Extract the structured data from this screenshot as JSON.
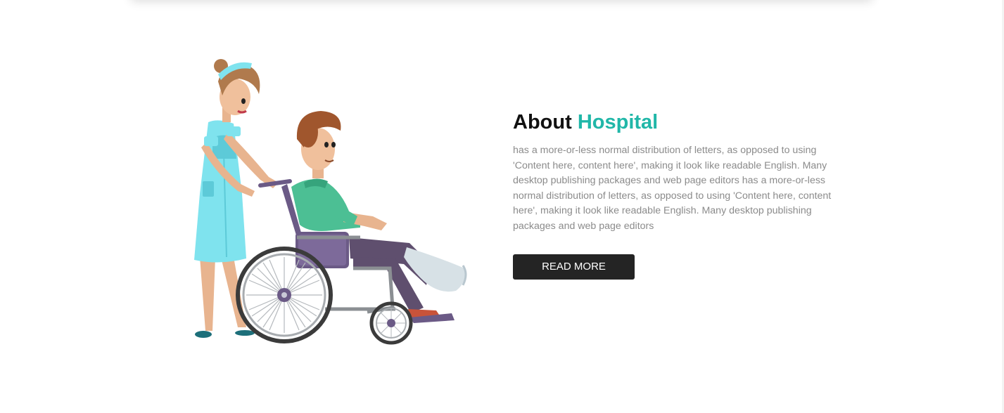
{
  "about": {
    "title_main": "About",
    "title_accent": "Hospital",
    "description": "has a more-or-less normal distribution of letters, as opposed to using 'Content here, content here', making it look like readable English. Many desktop publishing packages and web page editors has a more-or-less normal distribution of letters, as opposed to using 'Content here, content here', making it look like readable English. Many desktop publishing packages and web page editors",
    "button_label": "READ MORE"
  },
  "colors": {
    "accent": "#20b7a8",
    "button_bg": "#242424",
    "text_muted": "#8b8b8b"
  },
  "illustration": {
    "subject": "nurse-pushing-patient-in-wheelchair"
  }
}
